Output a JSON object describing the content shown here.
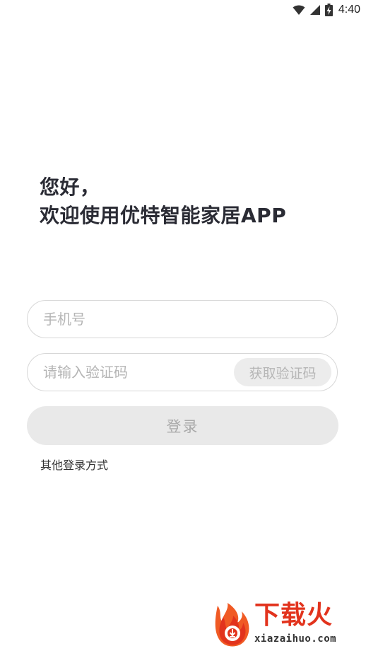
{
  "status_bar": {
    "time": "4:40",
    "icons": [
      "wifi-icon",
      "signal-icon",
      "battery-charging-icon"
    ]
  },
  "greeting": {
    "line1": "您好，",
    "line2": "欢迎使用优特智能家居APP"
  },
  "phone": {
    "placeholder": "手机号",
    "value": ""
  },
  "code": {
    "placeholder": "请输入验证码",
    "value": "",
    "button_label": "获取验证码"
  },
  "login_button": "登录",
  "other_login": "其他登录方式",
  "watermark": {
    "title": "下载火",
    "url": "xiazaihuo.com",
    "brand_color": "#e2331d"
  },
  "colors": {
    "text_primary": "#2a2b34",
    "placeholder": "#b5b5b5",
    "button_disabled_bg": "#e9e9e9",
    "button_disabled_text": "#a9a9a9",
    "field_border": "#d7d7d7"
  }
}
